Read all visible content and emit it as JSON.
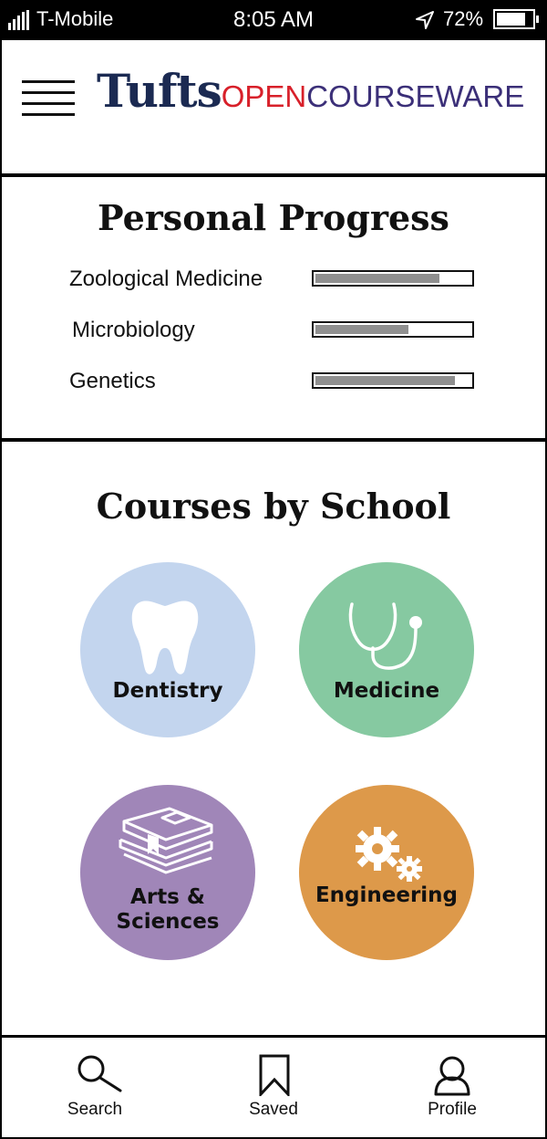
{
  "status_bar": {
    "carrier": "T-Mobile",
    "time": "8:05 AM",
    "battery": "72%",
    "icons": [
      "signal-icon",
      "location-arrow-icon",
      "battery-icon"
    ]
  },
  "header": {
    "menu_icon": "hamburger-icon",
    "brand_primary": "Tufts",
    "brand_open": "OPEN",
    "brand_courseware": "COURSEWARE",
    "colors": {
      "tufts": "#1b2a52",
      "open": "#d8202a",
      "courseware": "#3b2f78"
    }
  },
  "personal_progress": {
    "title": "Personal Progress",
    "courses": [
      {
        "name": "Zoological Medicine",
        "progress": 0.8
      },
      {
        "name": "Microbiology",
        "progress": 0.6
      },
      {
        "name": "Genetics",
        "progress": 0.9
      }
    ]
  },
  "courses_by_school": {
    "title": "Courses by School",
    "schools": [
      {
        "label": "Dentistry",
        "icon": "tooth-icon",
        "color": "#c3d5ee"
      },
      {
        "label": "Medicine",
        "icon": "stethoscope-icon",
        "color": "#86c9a1"
      },
      {
        "label_line1": "Arts &",
        "label_line2": "Sciences",
        "icon": "books-icon",
        "color": "#a086b8"
      },
      {
        "label": "Engineering",
        "icon": "gears-icon",
        "color": "#dd994a"
      }
    ]
  },
  "bottom_nav": {
    "items": [
      {
        "label": "Search",
        "icon": "search-icon"
      },
      {
        "label": "Saved",
        "icon": "bookmark-icon"
      },
      {
        "label": "Profile",
        "icon": "profile-icon"
      }
    ]
  }
}
